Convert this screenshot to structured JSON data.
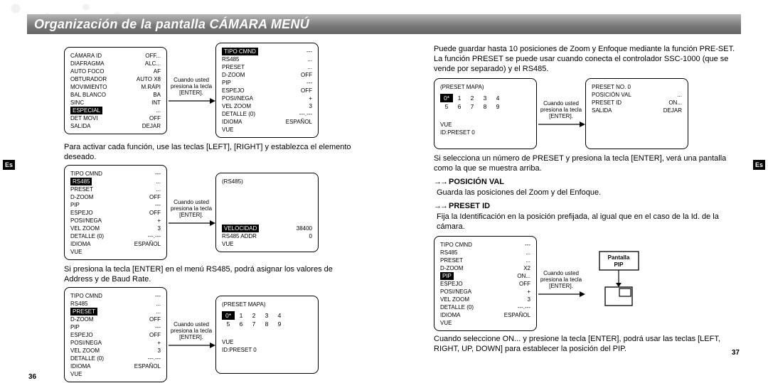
{
  "title": "Organización de la pantalla CÁMARA MENÚ",
  "lang_tab": "Es",
  "arrow_caption": {
    "l1": "Cuando usted",
    "l2": "presiona la tecla",
    "l3": "[ENTER]."
  },
  "left": {
    "p1": {
      "rows": [
        [
          "CÁMARA ID",
          "OFF..."
        ],
        [
          "DIAFRAGMA",
          "ALC..."
        ],
        [
          "AUTO FOCO",
          "AF"
        ],
        [
          "OBTURADOR",
          "AUTO X8"
        ],
        [
          "MOVIMIENTO",
          "M.RÁPI"
        ],
        [
          "BAL BLANCO",
          "BA"
        ],
        [
          "SINC",
          "INT"
        ],
        [
          "ESPECIAL",
          "..."
        ],
        [
          "DET MOVI",
          "OFF"
        ],
        [
          "SALIDA",
          "DEJAR"
        ]
      ],
      "highlight_idx": 7
    },
    "p2": {
      "title": "TIPO CMND",
      "rows": [
        [
          "RS485",
          "..."
        ],
        [
          "PRESET",
          "..."
        ],
        [
          "D-ZOOM",
          "OFF"
        ],
        [
          "PIP",
          "---"
        ],
        [
          "ESPEJO",
          "OFF"
        ],
        [
          "POSI/NEGA",
          "+"
        ],
        [
          "VEL ZOOM",
          "3"
        ],
        [
          "DETALLE (0)",
          "---.---"
        ],
        [
          "IDIOMA",
          "ESPAÑOL"
        ],
        [
          "VUE",
          ""
        ]
      ]
    },
    "text1": "Para activar cada función, use las teclas [LEFT], [RIGHT] y establezca el elemento deseado.",
    "p3": {
      "rows": [
        [
          "TIPO CMND",
          "---"
        ],
        [
          "RS485",
          "..."
        ],
        [
          "PRESET",
          "..."
        ],
        [
          "D-ZOOM",
          "OFF"
        ],
        [
          "PIP",
          "---"
        ],
        [
          "ESPEJO",
          "OFF"
        ],
        [
          "POSI/NEGA",
          "+"
        ],
        [
          "VEL ZOOM",
          "3"
        ],
        [
          "DETALLE (0)",
          "---.---"
        ],
        [
          "IDIOMA",
          "ESPAÑOL"
        ],
        [
          "VUE",
          ""
        ]
      ],
      "highlight_idx": 1
    },
    "p4": {
      "title": "(RS485)",
      "rows": [
        [
          "VELOCIDAD",
          "38400"
        ],
        [
          "RS485 ADDR",
          "0"
        ],
        [
          "VUE",
          ""
        ]
      ],
      "hl_first": true,
      "pad_before": 5
    },
    "text2": "Si presiona la tecla [ENTER] en el menú RS485, podrá asignar los valores de Address y de Baud Rate.",
    "p5": {
      "rows": [
        [
          "TIPO CMND",
          "---"
        ],
        [
          "RS485",
          "..."
        ],
        [
          "PRESET",
          "..."
        ],
        [
          "D-ZOOM",
          "OFF"
        ],
        [
          "PIP",
          "---"
        ],
        [
          "ESPEJO",
          "OFF"
        ],
        [
          "POSI/NEGA",
          "+"
        ],
        [
          "VEL ZOOM",
          "3"
        ],
        [
          "DETALLE (0)",
          "---.---"
        ],
        [
          "IDIOMA",
          "ESPAÑOL"
        ],
        [
          "VUE",
          ""
        ]
      ],
      "highlight_idx": 2
    },
    "p6": {
      "title": "(PRESET MAPA)",
      "grid": {
        "r1": [
          "0",
          "1",
          "2",
          "3",
          "4"
        ],
        "r2": [
          "5",
          "6",
          "7",
          "8",
          "9"
        ],
        "sel": "0"
      },
      "extra": [
        [
          "VUE",
          ""
        ],
        [
          "ID:PRESET 0",
          ""
        ]
      ]
    },
    "page_no": "36"
  },
  "right": {
    "intro": "Puede guardar hasta 10 posiciones de Zoom y Enfoque mediante la función PRE-SET. La función PRESET se puede usar cuando conecta el controlador SSC-1000 (que se vende por separado) y el RS485.",
    "p7": {
      "title": "(PRESET MAPA)",
      "grid": {
        "r1": [
          "0",
          "1",
          "2",
          "3",
          "4"
        ],
        "r2": [
          "5",
          "6",
          "7",
          "8",
          "9"
        ],
        "sel": "0"
      },
      "extra": [
        [
          "VUE",
          ""
        ],
        [
          "ID:PRESET 0",
          ""
        ]
      ]
    },
    "p8": {
      "rows": [
        [
          "PRESET NO. 0",
          ""
        ],
        [
          "POSICIÓN VAL",
          "..."
        ],
        [
          "PRESET ID",
          "ON..."
        ],
        [
          "",
          ""
        ],
        [
          "",
          ""
        ],
        [
          "",
          ""
        ],
        [
          "SALIDA",
          "DEJAR"
        ]
      ]
    },
    "text1": "Si selecciona un número de PRESET y presiona la tecla [ENTER], verá una pantalla como la que se muestra arriba.",
    "h1": "POSICIÓN VAL",
    "h1_body": "Guarda las posiciones del Zoom y del Enfoque.",
    "h2": "PRESET ID",
    "h2_body": "Fija la Identificación en la posición prefijada, al igual que en el caso de la Id. de la cámara.",
    "p9": {
      "rows": [
        [
          "TIPO CMND",
          "---"
        ],
        [
          "RS485",
          "..."
        ],
        [
          "PRESET",
          "..."
        ],
        [
          "D-ZOOM",
          "X2"
        ],
        [
          "PIP",
          "ON..."
        ],
        [
          "ESPEJO",
          "OFF"
        ],
        [
          "POSI/NEGA",
          "+"
        ],
        [
          "VEL ZOOM",
          "3"
        ],
        [
          "DETALLE (0)",
          "---.---"
        ],
        [
          "IDIOMA",
          "ESPAÑOL"
        ],
        [
          "VUE",
          ""
        ]
      ],
      "highlight_idx": 4
    },
    "pip_box": {
      "l1": "Pantalla",
      "l2": "PIP"
    },
    "text2": "Cuando seleccione ON... y presione la tecla [ENTER], podrá usar las teclas [LEFT, RIGHT, UP, DOWN] para establecer la posición del PIP.",
    "page_no": "37"
  }
}
